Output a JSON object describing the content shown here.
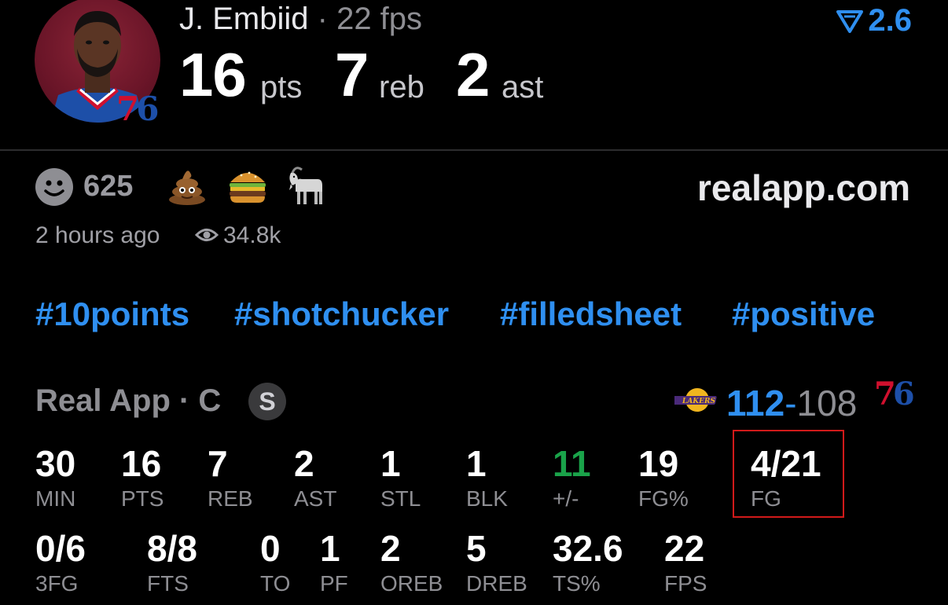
{
  "player": {
    "name": "J. Embiid",
    "separator": "·",
    "fps": "22 fps",
    "team_logo_left": "7",
    "team_logo_right": "6"
  },
  "headline_stats": [
    {
      "value": "16",
      "unit": "pts"
    },
    {
      "value": "7",
      "unit": "reb"
    },
    {
      "value": "2",
      "unit": "ast"
    }
  ],
  "rating": {
    "value": "2.6",
    "icon": "rating-triangle-icon"
  },
  "reactions": {
    "count": "625",
    "emojis": [
      "poop-emoji-icon",
      "burger-emoji-icon",
      "goat-emoji-icon"
    ]
  },
  "site": "realapp.com",
  "meta": {
    "time": "2 hours ago",
    "views": "34.8k"
  },
  "hashtags": [
    "#10points",
    "#shotchucker",
    "#filledsheet",
    "#positive"
  ],
  "source": {
    "label": "Real App · C",
    "badge": "S"
  },
  "score": {
    "home": "112",
    "dash": "-",
    "away": "108",
    "away_logo_left": "7",
    "away_logo_right": "6"
  },
  "stats_row1": [
    {
      "value": "30",
      "label": "MIN"
    },
    {
      "value": "16",
      "label": "PTS"
    },
    {
      "value": "7",
      "label": "REB"
    },
    {
      "value": "2",
      "label": "AST"
    },
    {
      "value": "1",
      "label": "STL"
    },
    {
      "value": "1",
      "label": "BLK"
    },
    {
      "value": "11",
      "label": "+/-"
    },
    {
      "value": "19",
      "label": "FG%"
    },
    {
      "value": "4/21",
      "label": "FG"
    }
  ],
  "stats_row2": [
    {
      "value": "0/6",
      "label": "3FG"
    },
    {
      "value": "8/8",
      "label": "FTS"
    },
    {
      "value": "0",
      "label": "TO"
    },
    {
      "value": "1",
      "label": "PF"
    },
    {
      "value": "2",
      "label": "OREB"
    },
    {
      "value": "5",
      "label": "DREB"
    },
    {
      "value": "32.6",
      "label": "TS%"
    },
    {
      "value": "22",
      "label": "FPS"
    }
  ],
  "colors": {
    "accent": "#2f8ff0",
    "positive": "#1aa34a",
    "highlight": "#d11a1a"
  }
}
